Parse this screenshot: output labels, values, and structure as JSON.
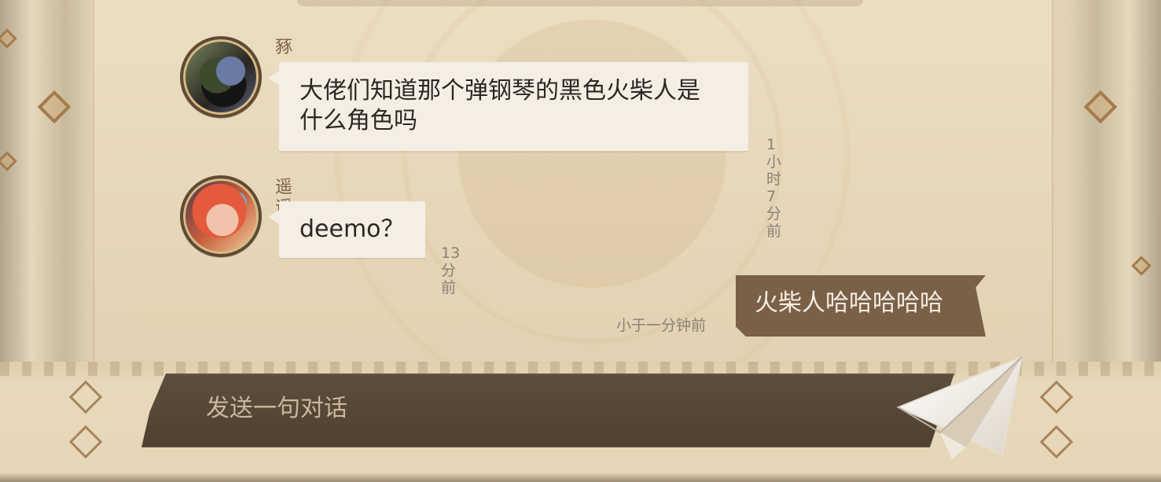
{
  "chat": {
    "messages": [
      {
        "name": "豩",
        "text": "大佬们知道那个弹钢琴的黑色火柴人是\n什么角色吗",
        "time": "1小时7分前"
      },
      {
        "name": "遥遥",
        "text": "deemo？",
        "time": "13分前"
      }
    ],
    "my_message": {
      "text": "火柴人哈哈哈哈哈",
      "time": "小于一分钟前"
    },
    "input": {
      "placeholder": "发送一句对话"
    }
  }
}
